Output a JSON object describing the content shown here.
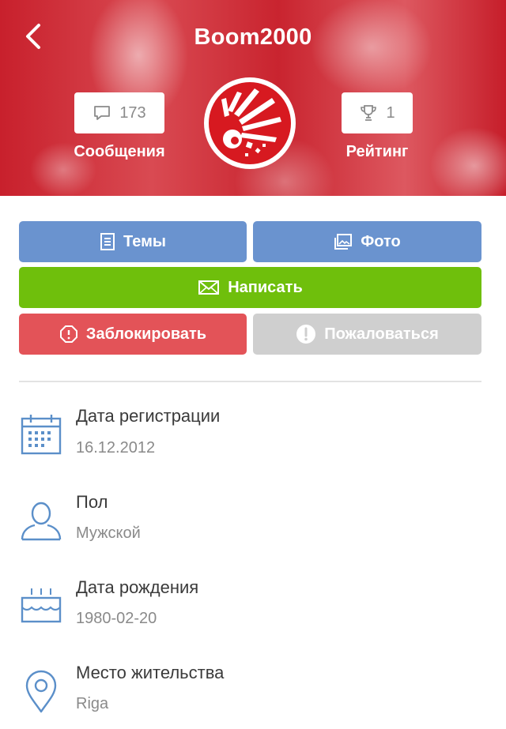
{
  "header": {
    "title": "Boom2000",
    "back_icon": "chevron-left-icon",
    "messages": {
      "count": "173",
      "label": "Сообщения",
      "icon": "chat-bubble-icon"
    },
    "rating": {
      "count": "1",
      "label": "Рейтинг",
      "icon": "trophy-icon"
    },
    "avatar_icon": "explosion-icon"
  },
  "actions": {
    "topics_label": "Темы",
    "photo_label": "Фото",
    "write_label": "Написать",
    "block_label": "Заблокировать",
    "report_label": "Пожаловаться"
  },
  "info": [
    {
      "label": "Дата регистрации",
      "value": "16.12.2012",
      "icon": "calendar-icon"
    },
    {
      "label": "Пол",
      "value": "Мужской",
      "icon": "person-icon"
    },
    {
      "label": "Дата рождения",
      "value": "1980-02-20",
      "icon": "birthday-cake-icon"
    },
    {
      "label": "Место жительства",
      "value": "Riga",
      "icon": "location-pin-icon"
    }
  ],
  "colors": {
    "header_red": "#c8202c",
    "blue": "#6a93cf",
    "green": "#6fbf0c",
    "red": "#e35358",
    "gray": "#cfcfcf",
    "icon_blue": "#5b8fc9"
  }
}
